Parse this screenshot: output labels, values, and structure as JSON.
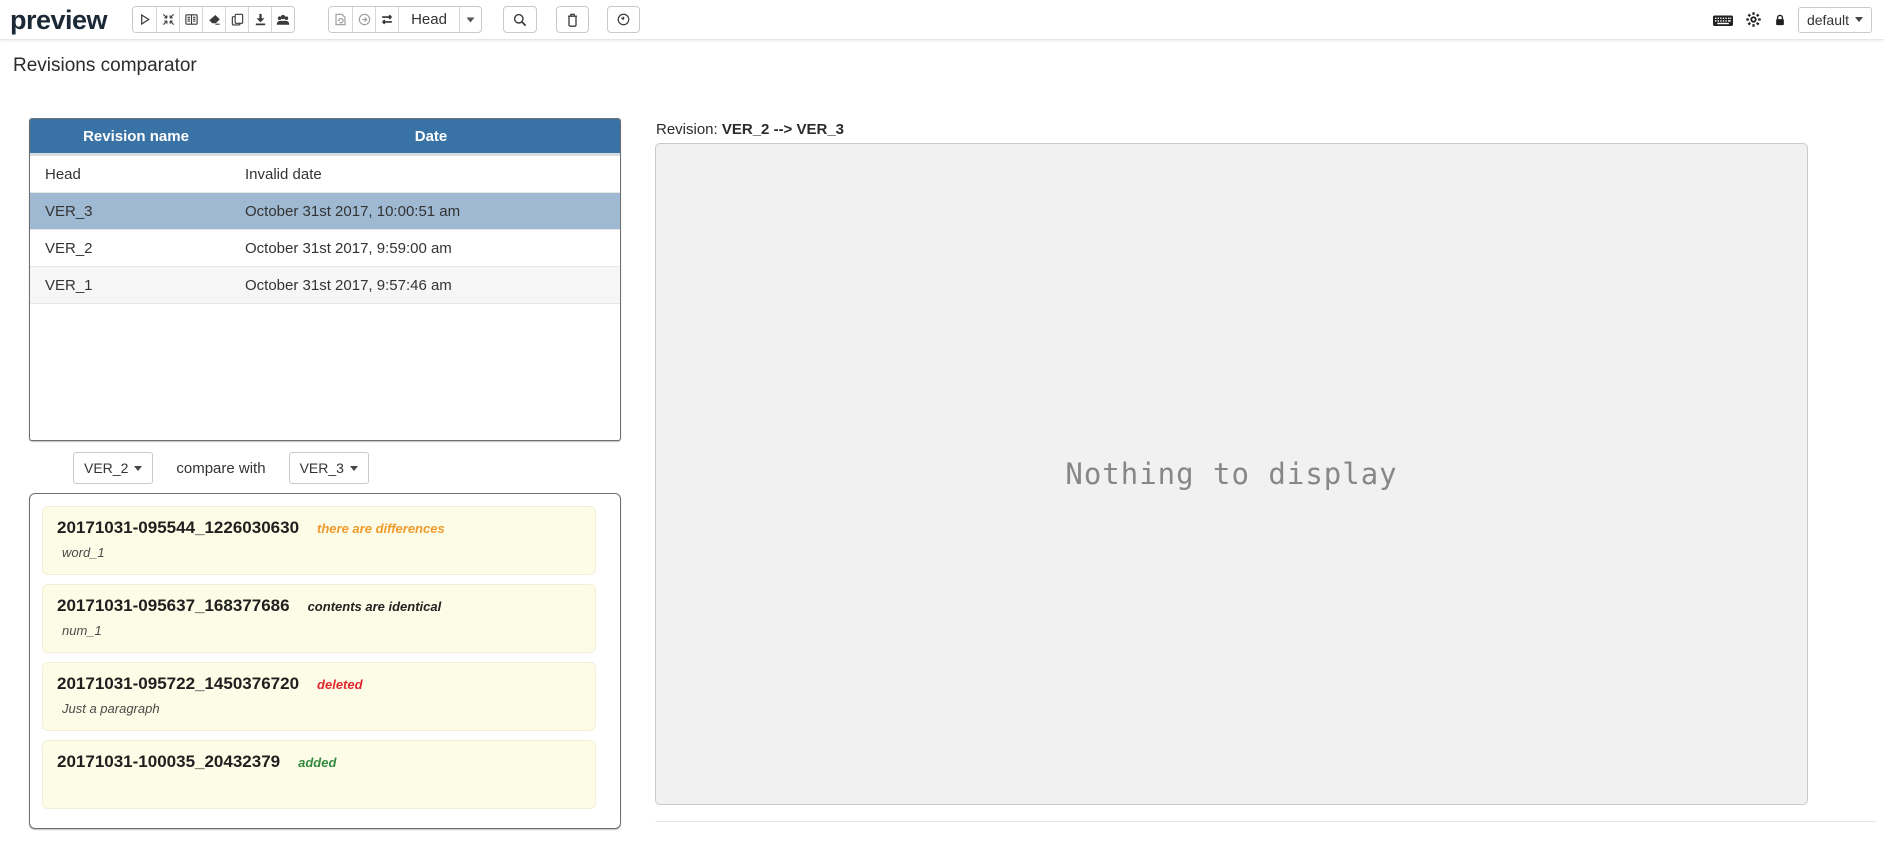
{
  "toolbar": {
    "logo": "preview",
    "revision_select": {
      "value": "Head"
    },
    "profile_select": {
      "value": "default"
    },
    "icons": {
      "group_actions": [
        "play",
        "compress",
        "book-open",
        "eraser",
        "copy",
        "download",
        "users"
      ],
      "group_revision": [
        "file-refresh",
        "arrow-circle-right",
        "swap"
      ],
      "singles": [
        "search",
        "trash",
        "clock"
      ],
      "right": [
        "keyboard",
        "gear",
        "lock"
      ]
    }
  },
  "page": {
    "title": "Revisions comparator"
  },
  "revisions_table": {
    "columns": [
      "Revision name",
      "Date"
    ],
    "rows": [
      {
        "name": "Head",
        "date": "Invalid date",
        "selected": false
      },
      {
        "name": "VER_3",
        "date": "October 31st 2017, 10:00:51 am",
        "selected": true
      },
      {
        "name": "VER_2",
        "date": "October 31st 2017, 9:59:00 am",
        "selected": false
      },
      {
        "name": "VER_1",
        "date": "October 31st 2017, 9:57:46 am",
        "selected": false
      }
    ]
  },
  "compare_bar": {
    "left_value": "VER_2",
    "label": "compare with",
    "right_value": "VER_3"
  },
  "diff_list": {
    "items": [
      {
        "title": "20171031-095544_1226030630",
        "status": "there are differences",
        "status_type": "differences",
        "subtitle": "word_1"
      },
      {
        "title": "20171031-095637_168377686",
        "status": "contents are identical",
        "status_type": "identical",
        "subtitle": "num_1"
      },
      {
        "title": "20171031-095722_1450376720",
        "status": "deleted",
        "status_type": "deleted",
        "subtitle": "Just a paragraph"
      },
      {
        "title": "20171031-100035_20432379",
        "status": "added",
        "status_type": "added",
        "subtitle": ""
      }
    ]
  },
  "preview_panel": {
    "label": "Revision:",
    "revision_range": "VER_2 --> VER_3",
    "empty_message": "Nothing to display"
  },
  "colors": {
    "table_header": "#3973a6",
    "selected_row": "#9fb9d2",
    "item_bg": "#fdfce6",
    "status_differences": "#ef9a2d",
    "status_identical": "#222222",
    "status_deleted": "#e0262e",
    "status_added": "#338a3e"
  }
}
